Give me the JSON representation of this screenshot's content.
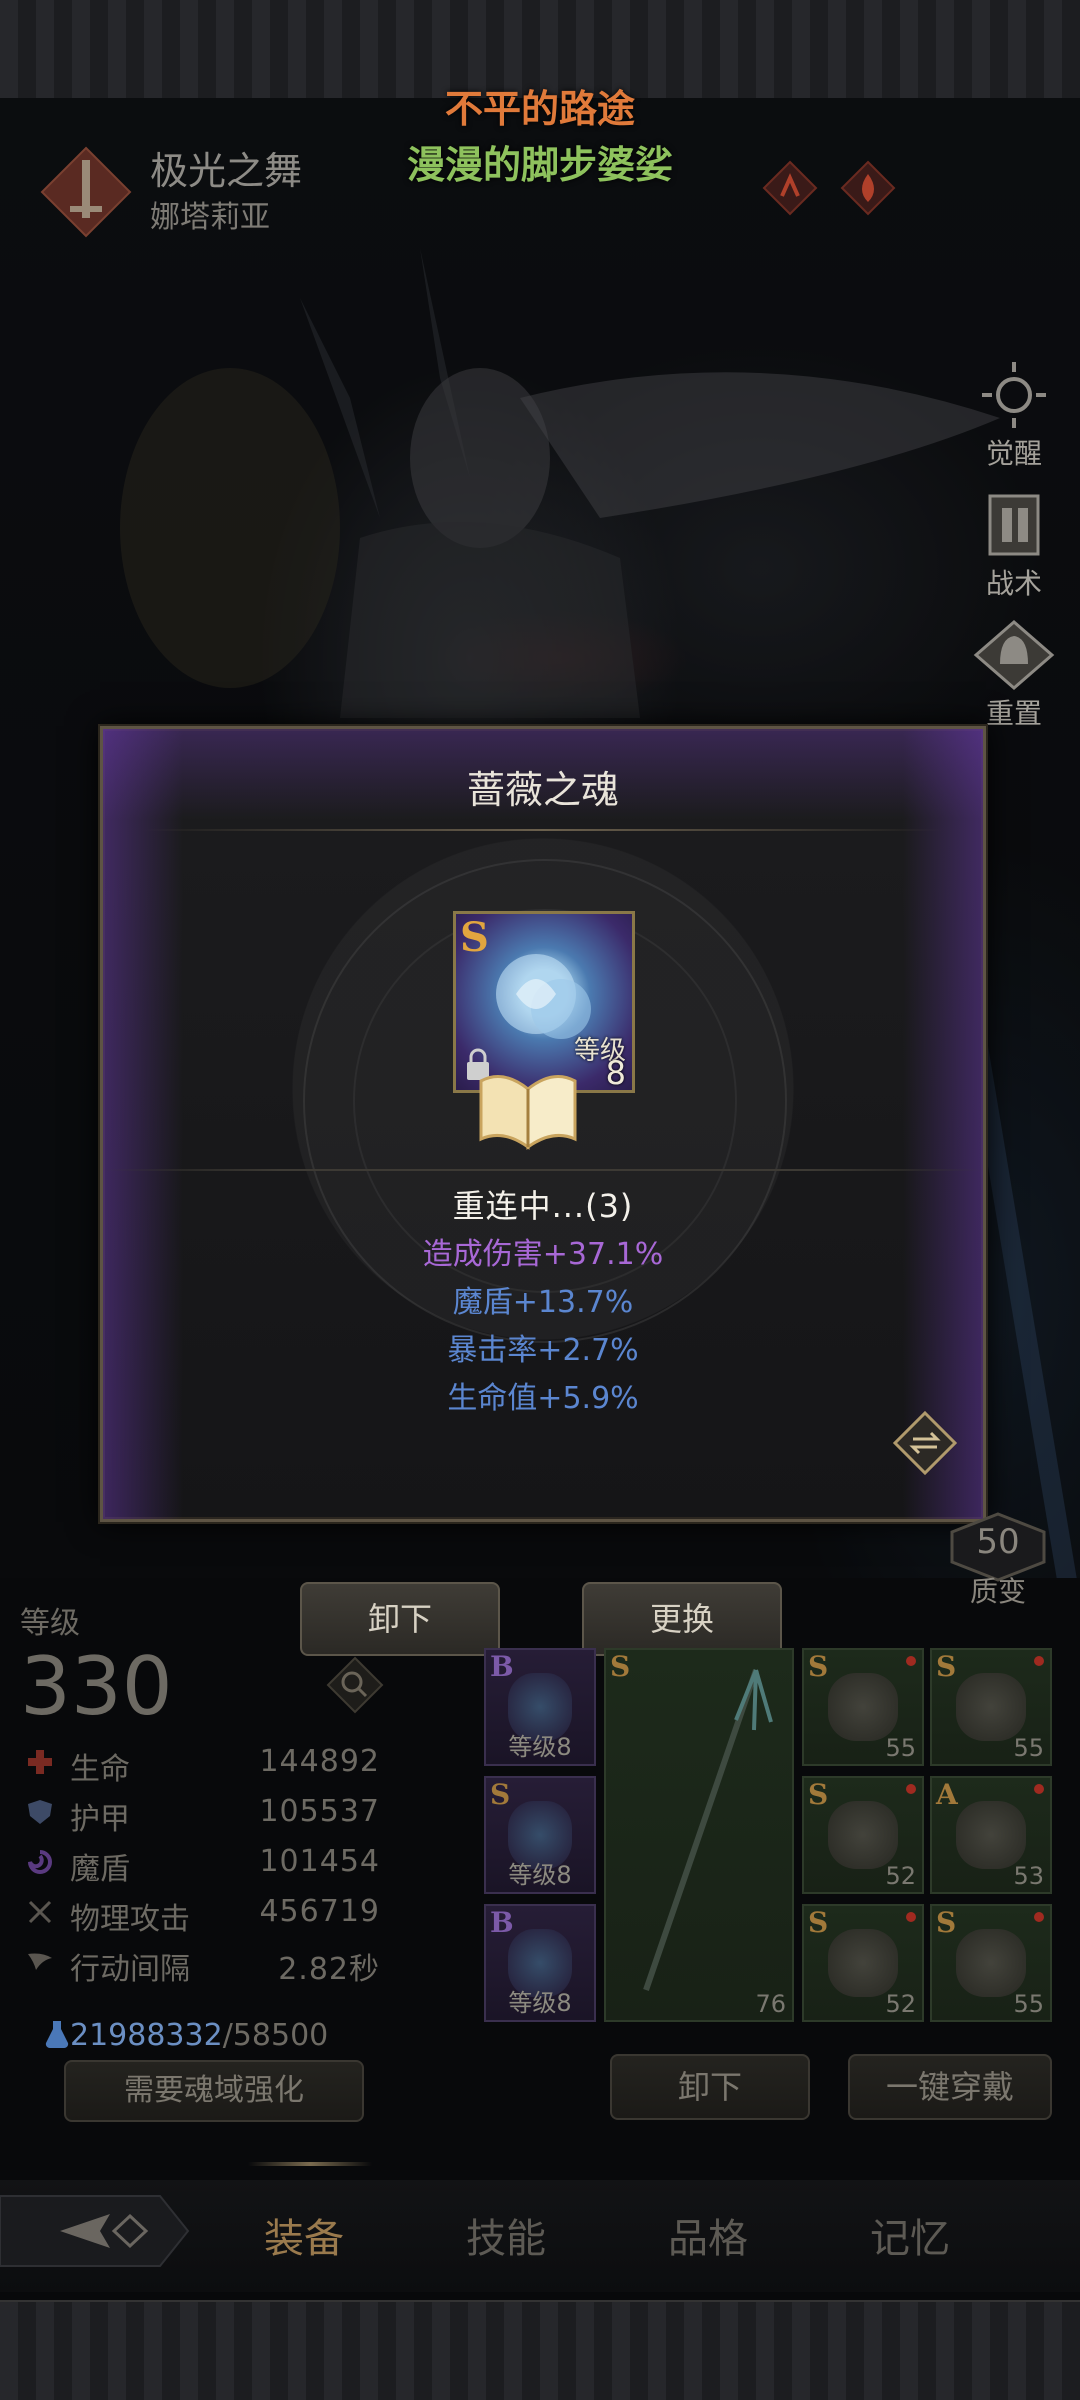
{
  "hero": {
    "name": "极光之舞",
    "subtitle": "娜塔莉亚"
  },
  "banner": {
    "line1": "不平的路途",
    "line2": "漫漫的脚步婆娑"
  },
  "side_menu": [
    {
      "label": "觉醒",
      "icon": "sun-emblem-icon"
    },
    {
      "label": "战术",
      "icon": "gate-icon"
    },
    {
      "label": "重置",
      "icon": "helmet-icon"
    }
  ],
  "transform": {
    "value": "50",
    "label": "质变"
  },
  "popup": {
    "title": "蔷薇之魂",
    "item": {
      "grade": "S",
      "level_label": "等级",
      "level": "8",
      "icon": "blue-rose-icon",
      "locked": true
    },
    "status": "重连中...(3)",
    "attributes": [
      "造成伤害+37.1%",
      "魔盾+13.7%",
      "暴击率+2.7%",
      "生命值+5.9%"
    ],
    "colors": {
      "primary_attr": "#a868d6",
      "secondary_attr": "#5b86d0"
    }
  },
  "actions": {
    "unequip": "卸下",
    "replace": "更换",
    "unequip_all": "卸下",
    "one_click_equip": "一键穿戴"
  },
  "stats": {
    "level_label": "等级",
    "level": "330",
    "rows": [
      {
        "name": "生命",
        "value": "144892",
        "icon": "hp-cross-icon"
      },
      {
        "name": "护甲",
        "value": "105537",
        "icon": "shield-icon"
      },
      {
        "name": "魔盾",
        "value": "101454",
        "icon": "magic-swirl-icon"
      },
      {
        "name": "物理攻击",
        "value": "456719",
        "icon": "crossed-swords-icon"
      },
      {
        "name": "行动间隔",
        "value": "2.82秒",
        "icon": "wing-icon"
      }
    ],
    "resource_current": "21988332",
    "resource_sep_max": "/58500",
    "soul_domain_button": "需要魂域强化"
  },
  "soul_slots": [
    {
      "grade": "B",
      "level": "等级8"
    },
    {
      "grade": "S",
      "level": "等级8"
    },
    {
      "grade": "B",
      "level": "等级8"
    }
  ],
  "weapon_slot": {
    "grade": "S",
    "level": "76"
  },
  "gear_slots": [
    {
      "grade": "S",
      "level": "55"
    },
    {
      "grade": "S",
      "level": "55"
    },
    {
      "grade": "S",
      "level": "52"
    },
    {
      "grade": "A",
      "level": "53"
    },
    {
      "grade": "S",
      "level": "52"
    },
    {
      "grade": "S",
      "level": "55"
    }
  ],
  "tabs": [
    "装备",
    "技能",
    "品格",
    "记忆"
  ]
}
